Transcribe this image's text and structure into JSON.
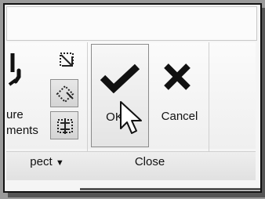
{
  "ribbon": {
    "partial_label_line1": "ure",
    "partial_label_line2": "ments",
    "ok_label": "OK",
    "cancel_label": "Cancel"
  },
  "groups": {
    "inspect_label": "pect",
    "close_label": "Close"
  },
  "icons": {
    "ok": "checkmark-icon",
    "cancel": "x-icon",
    "cursor": "mouse-pointer-icon",
    "dropdown": "caret-down-icon"
  },
  "colors": {
    "border": "#111111",
    "shadow": "#555555",
    "panel": "#f5f5f5"
  }
}
